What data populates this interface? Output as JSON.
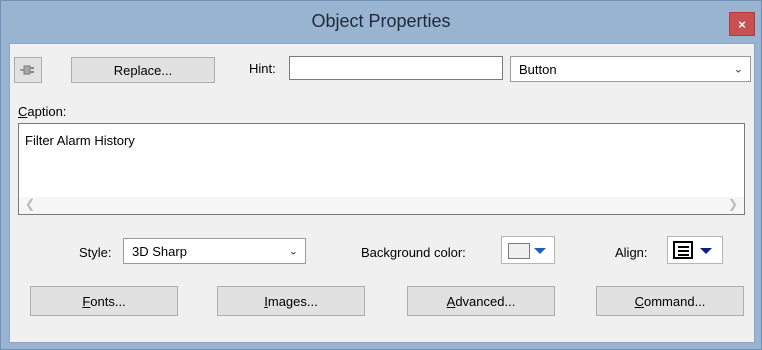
{
  "window": {
    "title": "Object Properties",
    "close_label": "×"
  },
  "toolbar": {
    "plug_icon": "plug-icon",
    "replace_label": "Replace...",
    "hint_label": "Hint:",
    "hint_value": "",
    "type_value": "Button"
  },
  "caption": {
    "label_first": "C",
    "label_rest": "aption:",
    "value": "Filter Alarm History"
  },
  "options": {
    "style_label": "Style:",
    "style_value": "3D Sharp",
    "background_label": "Background color:",
    "align_label": "Align:"
  },
  "buttons": {
    "fonts": {
      "first": "F",
      "rest": "onts..."
    },
    "images": {
      "first": "I",
      "rest": "mages..."
    },
    "advanced": {
      "first": "A",
      "rest": "dvanced..."
    },
    "command": {
      "first": "C",
      "rest": "ommand..."
    }
  },
  "colors": {
    "title_bar": "#99b4d1",
    "close": "#c75050",
    "dialog_bg": "#f0f0f0"
  }
}
